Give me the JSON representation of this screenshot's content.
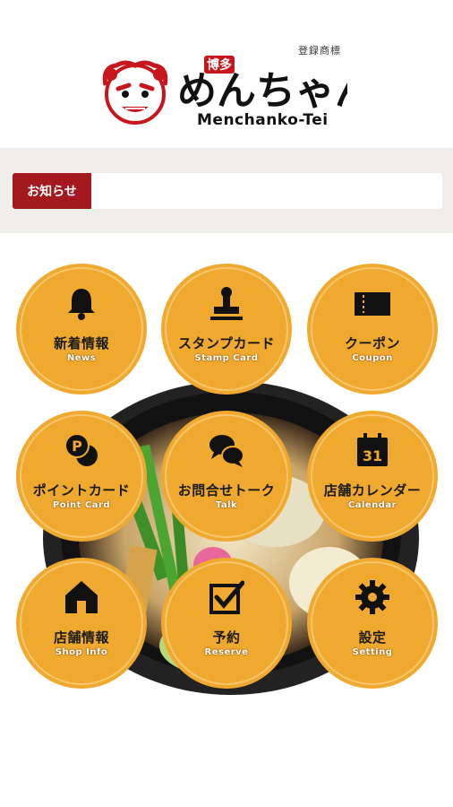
{
  "header": {
    "registered_mark": "登録商標",
    "logo_roman": "Menchanko-Tei",
    "logo_japanese": "博多めんちゃんこ亭"
  },
  "news": {
    "label": "お知らせ",
    "content": ""
  },
  "menu": [
    {
      "jp": "新着情報",
      "en": "News",
      "icon": "bell-icon"
    },
    {
      "jp": "スタンプカード",
      "en": "Stamp Card",
      "icon": "stamp-icon"
    },
    {
      "jp": "クーポン",
      "en": "Coupon",
      "icon": "coupon-icon"
    },
    {
      "jp": "ポイントカード",
      "en": "Point Card",
      "icon": "coins-icon"
    },
    {
      "jp": "お問合せトーク",
      "en": "Talk",
      "icon": "chat-bubbles-icon"
    },
    {
      "jp": "店舗カレンダー",
      "en": "Calendar",
      "icon": "calendar-icon",
      "calendar_day": "31"
    },
    {
      "jp": "店舗情報",
      "en": "Shop Info",
      "icon": "house-icon"
    },
    {
      "jp": "予約",
      "en": "Reserve",
      "icon": "checkbox-icon"
    },
    {
      "jp": "設定",
      "en": "Setting",
      "icon": "gear-icon"
    }
  ],
  "colors": {
    "brand_red": "#a3191d",
    "button_gold": "#f0a92f",
    "band_gray": "#f0eeea"
  }
}
